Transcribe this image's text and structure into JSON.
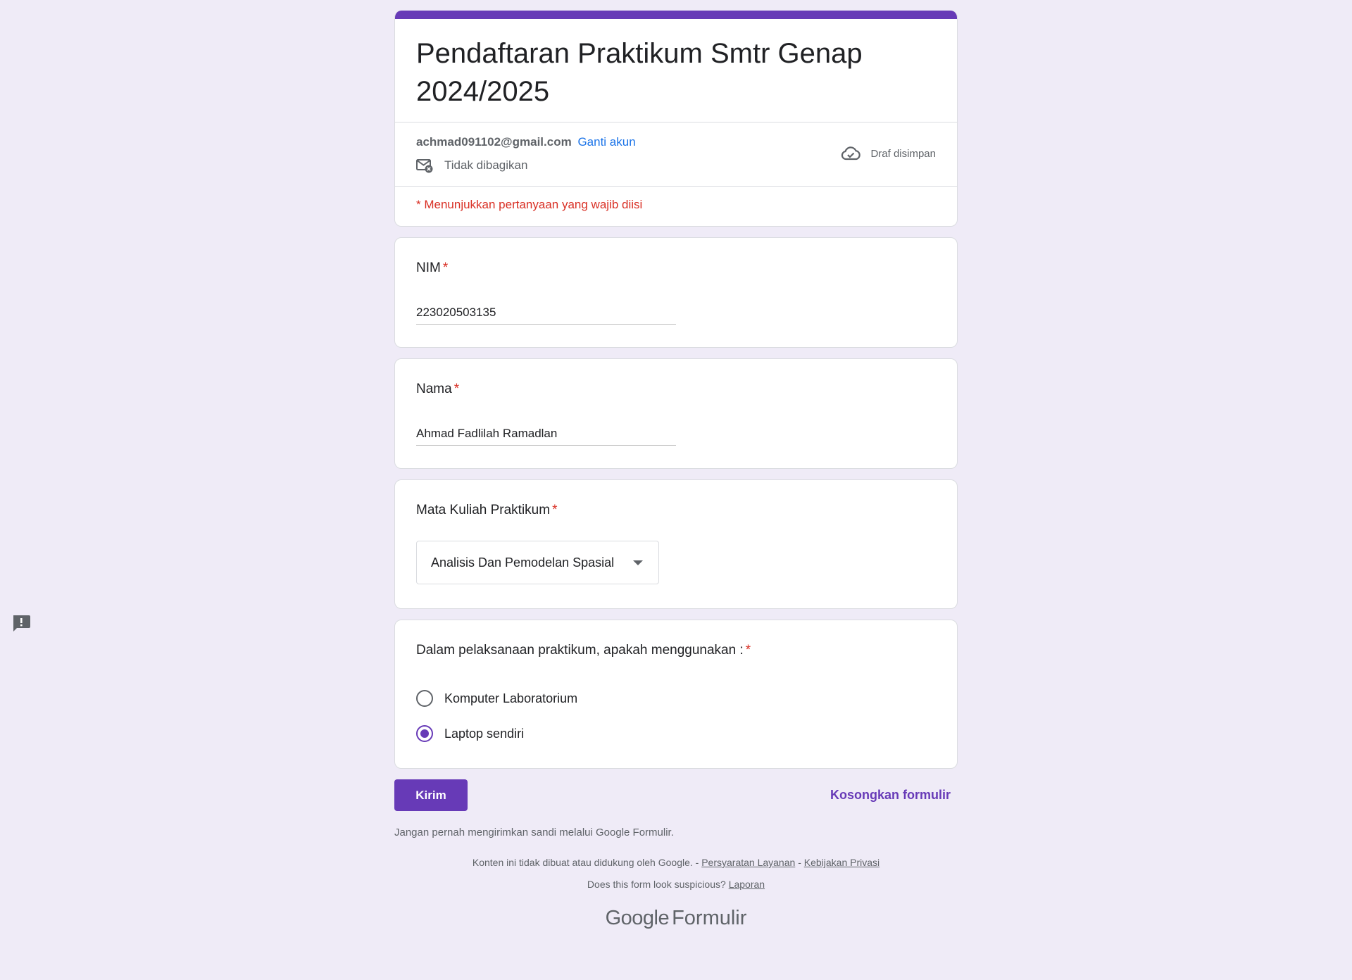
{
  "form": {
    "title": "Pendaftaran Praktikum Smtr Genap 2024/2025",
    "accent_color": "#673ab7"
  },
  "account": {
    "email": "achmad091102@gmail.com",
    "switch_label": "Ganti akun",
    "sharing_status": "Tidak dibagikan",
    "draft_status": "Draf disimpan"
  },
  "required_note": "* Menunjukkan pertanyaan yang wajib diisi",
  "questions": {
    "nim": {
      "title": "NIM",
      "asterisk": "*",
      "value": "223020503135"
    },
    "nama": {
      "title": "Nama",
      "asterisk": "*",
      "value": "Ahmad Fadlilah Ramadlan"
    },
    "mata_kuliah": {
      "title": "Mata Kuliah Praktikum",
      "asterisk": "*",
      "selected": "Analisis Dan Pemodelan Spasial"
    },
    "perangkat": {
      "title": "Dalam pelaksanaan praktikum, apakah menggunakan :",
      "asterisk": "*",
      "options": [
        {
          "label": "Komputer Laboratorium",
          "checked": false
        },
        {
          "label": "Laptop sendiri",
          "checked": true
        }
      ]
    }
  },
  "actions": {
    "submit_label": "Kirim",
    "clear_label": "Kosongkan formulir"
  },
  "footer": {
    "password_warning": "Jangan pernah mengirimkan sandi melalui Google Formulir.",
    "disclaimer": "Konten ini tidak dibuat atau didukung oleh Google. -",
    "terms_label": "Persyaratan Layanan",
    "separator": "-",
    "privacy_label": "Kebijakan Privasi",
    "suspicious_text": "Does this form look suspicious?",
    "report_label": "Laporan",
    "brand_google": "Google",
    "brand_product": "Formulir"
  }
}
